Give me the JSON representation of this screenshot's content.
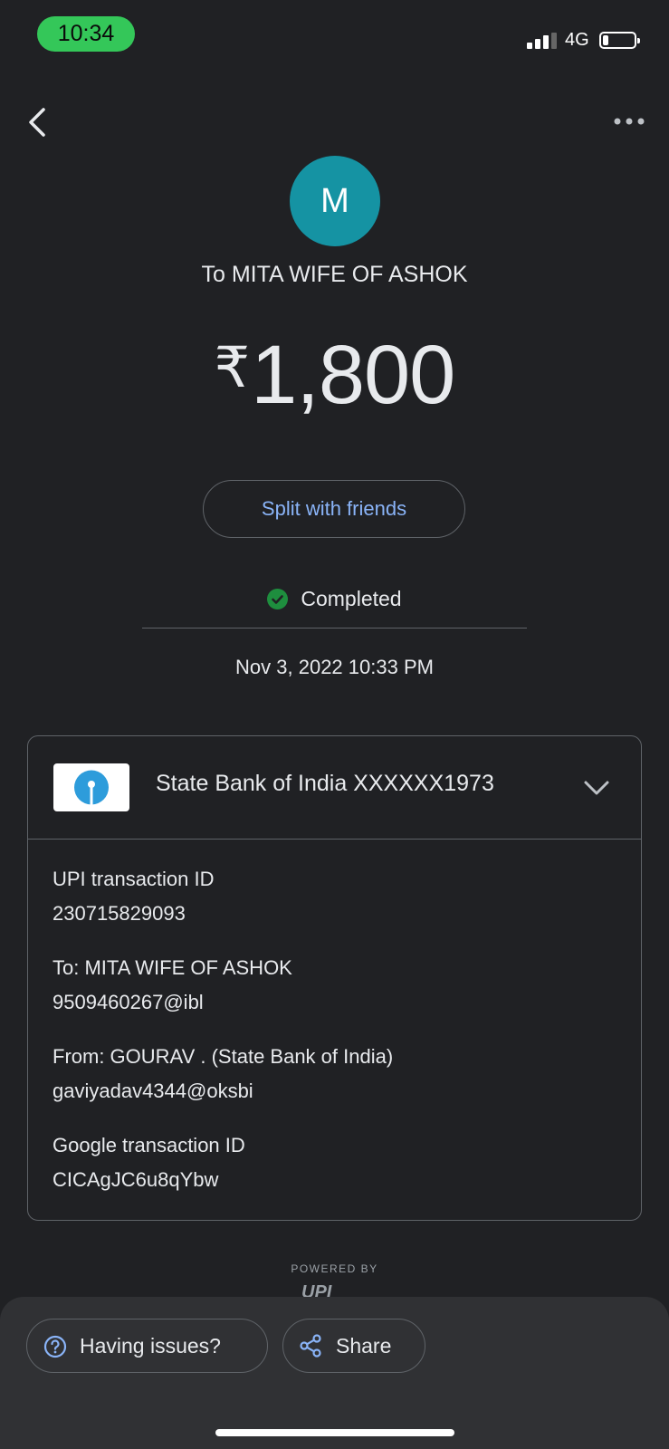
{
  "status_bar": {
    "time": "10:34",
    "network": "4G"
  },
  "payment": {
    "avatar_letter": "M",
    "payee": "To MITA WIFE OF ASHOK",
    "currency": "₹",
    "amount": "1,800",
    "split_label": "Split with friends",
    "status": "Completed",
    "datetime": "Nov 3, 2022 10:33 PM"
  },
  "details": {
    "bank_account": "State Bank of India XXXXXX1973",
    "rows": [
      {
        "label": "UPI transaction ID",
        "value": "230715829093"
      },
      {
        "label": "To: MITA WIFE OF ASHOK",
        "value": "9509460267@ibl"
      },
      {
        "label": "From: GOURAV  . (State Bank of India)",
        "value": "gaviyadav4344@oksbi"
      },
      {
        "label": "Google transaction ID",
        "value": "CICAgJC6u8qYbw"
      }
    ]
  },
  "footer": {
    "powered_by": "POWERED BY",
    "upi_logo_text": "UPI",
    "issues_label": "Having issues?",
    "share_label": "Share"
  },
  "colors": {
    "accent": "#8ab4f8",
    "success": "#1e8e3e",
    "avatar": "#1593a3",
    "time_pill": "#34c759"
  },
  "icons": [
    "back-arrow-icon",
    "more-options-icon",
    "check-circle-icon",
    "sbi-logo-icon",
    "chevron-down-icon",
    "help-icon",
    "share-icon"
  ]
}
